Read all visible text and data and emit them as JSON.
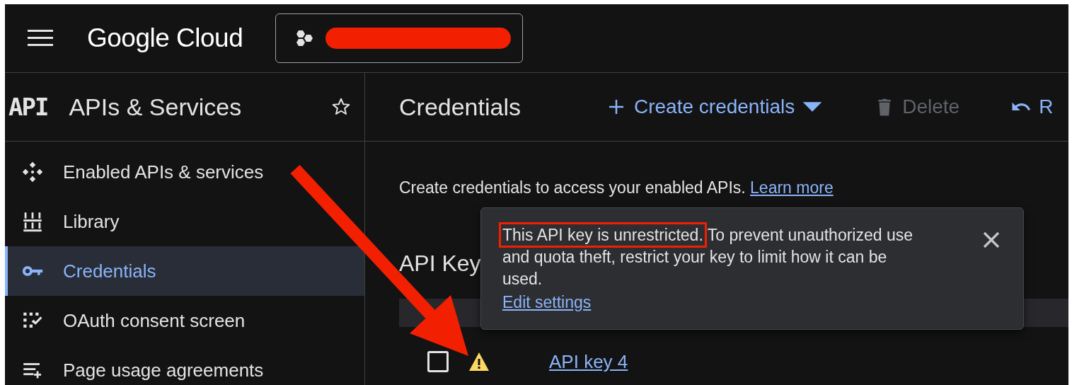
{
  "header": {
    "logo": "Google Cloud",
    "project_redacted": true
  },
  "sidebar": {
    "logo_text": "API",
    "title": "APIs & Services",
    "items": [
      {
        "label": "Enabled APIs & services",
        "kind": "enabled",
        "selected": false
      },
      {
        "label": "Library",
        "kind": "library",
        "selected": false
      },
      {
        "label": "Credentials",
        "kind": "key",
        "selected": true
      },
      {
        "label": "OAuth consent screen",
        "kind": "oauth",
        "selected": false
      },
      {
        "label": "Page usage agreements",
        "kind": "agreements",
        "selected": false
      }
    ]
  },
  "toolbar": {
    "title": "Credentials",
    "actions": [
      {
        "label": "Create credentials",
        "kind": "create",
        "disabled": false
      },
      {
        "label": "Delete",
        "kind": "delete",
        "disabled": true
      },
      {
        "label": "R",
        "kind": "undo",
        "disabled": false
      }
    ]
  },
  "intro": {
    "text": "Create credentials to access your enabled APIs.",
    "link": "Learn more"
  },
  "section_title": "API Key",
  "rows": [
    {
      "name": "API key 4",
      "checked": false,
      "warning": true
    }
  ],
  "tooltip": {
    "lead": "This API key is unrestricted.",
    "rest": " To prevent unauthorized use and quota theft, restrict your key to limit how it can be used.",
    "lead_highlighted": true,
    "link": "Edit settings"
  },
  "annotation": {
    "arrow": true
  }
}
